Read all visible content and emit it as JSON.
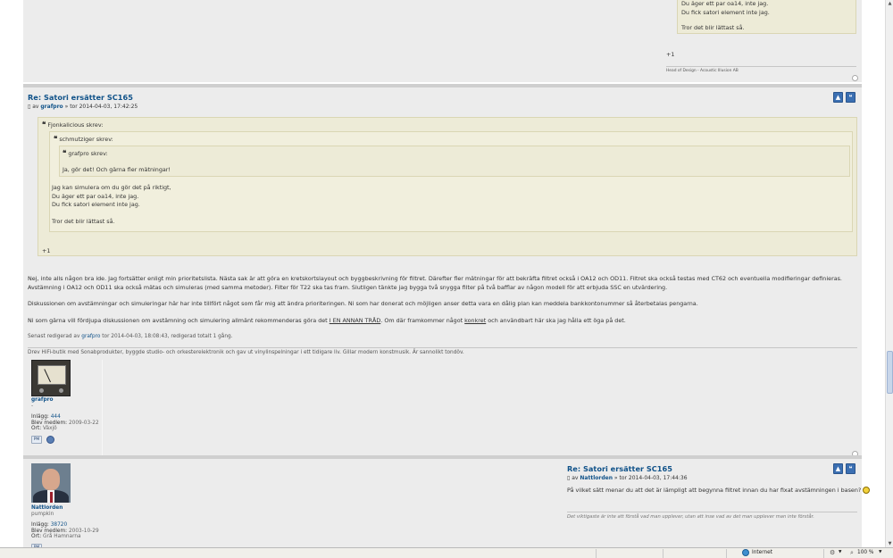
{
  "top_post": {
    "quote_lines": [
      "Du äger ett par oa14, inte jag.",
      "Du fick satori element inte jag.",
      "",
      "Tror det blir lättast så."
    ],
    "plus_one": "+1",
    "signature": "Head of Design - Acoustic Illusion AB"
  },
  "post_grafpro": {
    "title": "Re: Satori ersätter SC165",
    "by_label": "av",
    "author": "grafpro",
    "date": "» tor 2014-04-03, 17:42:25",
    "quote_outer": {
      "author": "Fjonkalicious skrev:",
      "inner": {
        "author": "schmutziger skrev:",
        "innermost": {
          "author": "grafpro skrev:",
          "text": "Ja, gör det! Och gärna fler mätningar!"
        },
        "lines": [
          "Jag kan simulera om du gör det på riktigt,",
          "Du äger ett par oa14, inte jag.",
          "Du fick satori element inte jag.",
          "",
          "Tror det blir lättast så."
        ]
      },
      "plus_one": "+1"
    },
    "paragraphs": [
      "Nej, inte alls någon bra ide. Jag fortsätter enligt min prioritetslista. Nästa sak är att göra en kretskortslayout och byggbeskrivning för filtret. Därefter fler mätningar för att bekräfta filtret också i OA12 och OD11. Filtret ska också testas med CT62 och eventuella modifieringar definieras. Avstämning i OA12 och OD11 ska också mätas och simuleras (med samma metoder). Filter för T22 ska tas fram. Slutligen tänkte jag bygga två snygga filter på två bafflar av någon modell för att erbjuda SSC en utvärdering.",
      "Diskussionen om avstämningar och simuleringar här har inte tillfört något som får mig att ändra prioriteringen. Ni som har donerat och möjligen anser detta vara en dålig plan kan meddela bankkontonummer så återbetalas pengarna."
    ],
    "p3_before": "Ni som gärna vill fördjupa diskussionen om avstämning och simulering allmänt rekommenderas göra det ",
    "p3_link1": "I EN ANNAN TRÅD",
    "p3_middle": ". Om där framkommer något ",
    "p3_link2": "konkret",
    "p3_after": " och användbart här ska jag hålla ett öga på det.",
    "edit_before": "Senast redigerad av ",
    "edit_user": "grafpro",
    "edit_after": " tor 2014-04-03, 18:08:43, redigerad totalt 1 gång.",
    "signature": "Drev HiFi-butik med Sonabprodukter, byggde studio- och orkesterelektronik och gav ut vinylinspelningar i ett tidigare liv. Gillar modern konstmusik. Är sannolikt tondöv.",
    "profile": {
      "username": "grafpro",
      "rank": "-",
      "posts_label": "Inlägg:",
      "posts": "444",
      "joined_label": "Blev medlem:",
      "joined": "2009-03-22",
      "location_label": "Ort:",
      "location": "Växjö",
      "pm_label": "PM"
    }
  },
  "post_nattlorden": {
    "title": "Re: Satori ersätter SC165",
    "by_label": "av",
    "author": "Nattlorden",
    "date": "» tor 2014-04-03, 17:44:36",
    "text": "På vilket sätt menar du att det är lämpligt att begynna filtret innan du har fixat avstämningen i basen?",
    "signature": "Det viktigaste är inte att förstå vad man upplever, utan att inse vad av det man upplever man inte förstår.",
    "profile": {
      "username": "Nattlorden",
      "rank": "pumpkin",
      "posts_label": "Inlägg:",
      "posts": "38720",
      "joined_label": "Blev medlem:",
      "joined": "2003-10-29",
      "location_label": "Ort:",
      "location": "Grå Hamnarna",
      "pm_label": "PM"
    }
  },
  "status_bar": {
    "zone": "Internet",
    "zoom": "100 %"
  },
  "colors": {
    "link": "#105289",
    "quote_bg": "#edebd7",
    "post_bg": "#ececec"
  }
}
